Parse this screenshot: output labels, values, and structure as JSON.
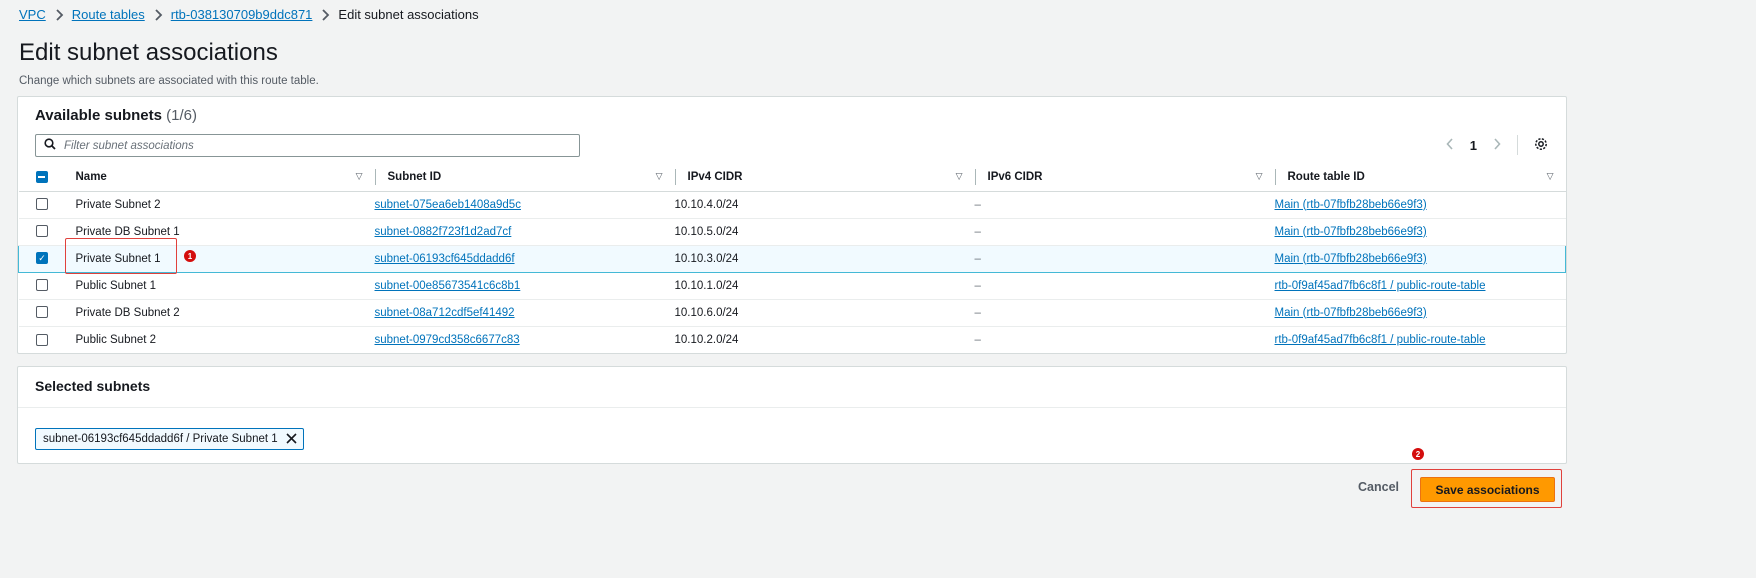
{
  "breadcrumb": {
    "items": [
      "VPC",
      "Route tables",
      "rtb-038130709b9ddc871"
    ],
    "current": "Edit subnet associations"
  },
  "page": {
    "title": "Edit subnet associations",
    "description": "Change which subnets are associated with this route table."
  },
  "available": {
    "title": "Available subnets",
    "count": "(1/6)",
    "filter_placeholder": "Filter subnet associations",
    "page_number": "1",
    "columns": [
      "Name",
      "Subnet ID",
      "IPv4 CIDR",
      "IPv6 CIDR",
      "Route table ID"
    ],
    "rows": [
      {
        "name": "Private Subnet 2",
        "subnet_id": "subnet-075ea6eb1408a9d5c",
        "ipv4": "10.10.4.0/24",
        "ipv6": "–",
        "route_table": "Main (rtb-07fbfb28beb66e9f3)",
        "checked": false
      },
      {
        "name": "Private DB Subnet 1",
        "subnet_id": "subnet-0882f723f1d2ad7cf",
        "ipv4": "10.10.5.0/24",
        "ipv6": "–",
        "route_table": "Main (rtb-07fbfb28beb66e9f3)",
        "checked": false
      },
      {
        "name": "Private Subnet 1",
        "subnet_id": "subnet-06193cf645ddadd6f",
        "ipv4": "10.10.3.0/24",
        "ipv6": "–",
        "route_table": "Main (rtb-07fbfb28beb66e9f3)",
        "checked": true
      },
      {
        "name": "Public Subnet 1",
        "subnet_id": "subnet-00e85673541c6c8b1",
        "ipv4": "10.10.1.0/24",
        "ipv6": "–",
        "route_table": "rtb-0f9af45ad7fb6c8f1 / public-route-table",
        "checked": false
      },
      {
        "name": "Private DB Subnet 2",
        "subnet_id": "subnet-08a712cdf5ef41492",
        "ipv4": "10.10.6.0/24",
        "ipv6": "–",
        "route_table": "Main (rtb-07fbfb28beb66e9f3)",
        "checked": false
      },
      {
        "name": "Public Subnet 2",
        "subnet_id": "subnet-0979cd358c6677c83",
        "ipv4": "10.10.2.0/24",
        "ipv6": "–",
        "route_table": "rtb-0f9af45ad7fb6c8f1 / public-route-table",
        "checked": false
      }
    ]
  },
  "selected": {
    "title": "Selected subnets",
    "token": "subnet-06193cf645ddadd6f / Private Subnet 1"
  },
  "annotations": {
    "step1": "1",
    "step2": "2"
  },
  "actions": {
    "cancel": "Cancel",
    "save": "Save associations"
  },
  "icons": {
    "breadcrumb_separator": "chevron-right-icon",
    "filter": "search-icon",
    "prev": "chevron-left-icon",
    "next": "chevron-right-icon",
    "settings": "gear-icon",
    "sort": "caret-down-icon",
    "remove_token": "close-icon"
  },
  "colors": {
    "link": "#0073bb",
    "primary_button": "#ff9900",
    "annotation": "#d40d0d",
    "selected_row": "#f1faff"
  }
}
